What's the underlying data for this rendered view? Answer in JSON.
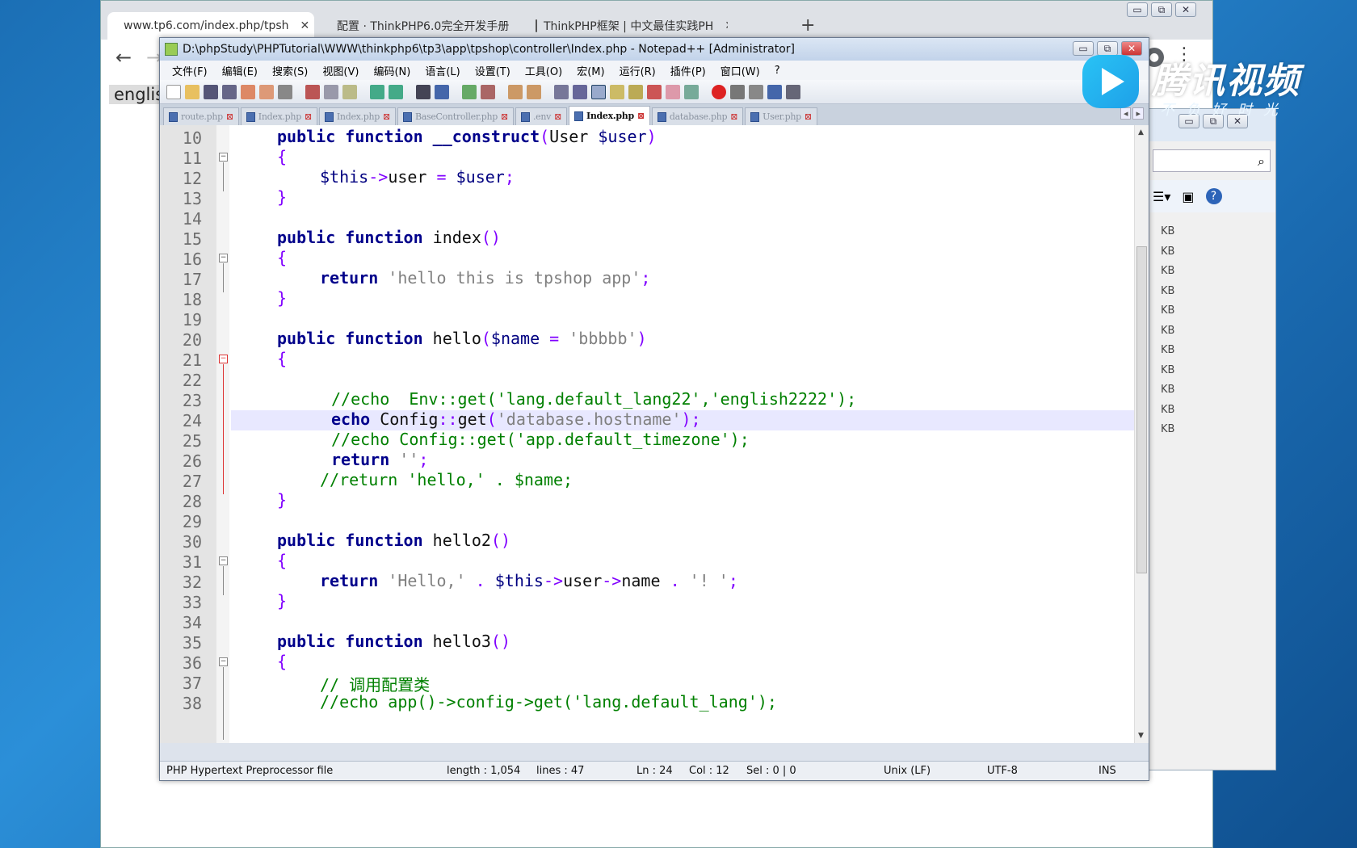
{
  "browser": {
    "tabs": [
      {
        "title": "www.tp6.com/index.php/tpsh",
        "close": "✕"
      },
      {
        "title": "配置 · ThinkPHP6.0完全开发手册",
        "close": "✕"
      },
      {
        "title": "ThinkPHP框架 | 中文最佳实践PH",
        "close": "✕"
      }
    ],
    "new_tab": "+",
    "page_text": "english",
    "win_buttons": [
      "▭",
      "⧉",
      "✕"
    ]
  },
  "explorer": {
    "kb_rows": [
      "KB",
      "KB",
      "KB",
      "KB",
      "KB",
      "KB",
      "KB",
      "KB",
      "KB",
      "KB",
      "KB"
    ],
    "win_buttons": [
      "▭",
      "⧉",
      "✕"
    ]
  },
  "npp": {
    "title": "D:\\phpStudy\\PHPTutorial\\WWW\\thinkphp6\\tp3\\app\\tpshop\\controller\\Index.php - Notepad++ [Administrator]",
    "win_buttons": [
      "▭",
      "⧉",
      "✕"
    ],
    "menu": [
      "文件(F)",
      "编辑(E)",
      "搜索(S)",
      "视图(V)",
      "编码(N)",
      "语言(L)",
      "设置(T)",
      "工具(O)",
      "宏(M)",
      "运行(R)",
      "插件(P)",
      "窗口(W)",
      "?"
    ],
    "file_tabs": [
      "route.php",
      "Index.php",
      "Index.php",
      "BaseController.php",
      ".env",
      "Index.php",
      "database.php",
      "User.php"
    ],
    "tab_arrows": [
      "◂",
      "▸"
    ],
    "status": {
      "lang": "PHP Hypertext Preprocessor file",
      "length": "length : 1,054",
      "lines": "lines : 47",
      "ln": "Ln : 24",
      "col": "Col : 12",
      "sel": "Sel : 0 | 0",
      "eol": "Unix (LF)",
      "enc": "UTF-8",
      "mode": "INS"
    },
    "line_numbers": [
      "10",
      "11",
      "12",
      "13",
      "14",
      "15",
      "16",
      "17",
      "18",
      "19",
      "20",
      "21",
      "22",
      "23",
      "24",
      "25",
      "26",
      "27",
      "28",
      "29",
      "30",
      "31",
      "32",
      "33",
      "34",
      "35",
      "36",
      "37",
      "38"
    ]
  },
  "code": {
    "l10a": "public function ",
    "l10b": "__construct",
    "l10c": "(",
    "l10d": "User ",
    "l10e": "$user",
    "l10f": ")",
    "brace_open": "{",
    "brace_close": "}",
    "l12a": "$this",
    "l12b": "->",
    "l12c": "user ",
    "l12d": "= ",
    "l12e": "$user",
    "l12f": ";",
    "l15a": "public function ",
    "l15b": "index",
    "l15c": "()",
    "l17a": "return ",
    "l17b": "'hello this is tpshop app'",
    "l17c": ";",
    "l20a": "public function ",
    "l20b": "hello",
    "l20c": "(",
    "l20d": "$name ",
    "l20e": "= ",
    "l20f": "'bbbbb'",
    "l20g": ")",
    "l23": "//echo  Env::get('lang.default_lang22','english2222');",
    "l24a": "echo ",
    "l24b": "Config",
    "l24c": "::",
    "l24d": "get",
    "l24e": "(",
    "l24f": "'database.hostname'",
    "l24g": ");",
    "l25": "//echo Config::get('app.default_timezone');",
    "l26a": "return ",
    "l26b": "''",
    "l26c": ";",
    "l27": "//return 'hello,' . $name;",
    "l30a": "public function ",
    "l30b": "hello2",
    "l30c": "()",
    "l32a": "return ",
    "l32b": "'Hello,' ",
    "l32c": ". ",
    "l32d": "$this",
    "l32e": "->",
    "l32f": "user",
    "l32g": "->",
    "l32h": "name ",
    "l32i": ". ",
    "l32j": "'! '",
    "l32k": ";",
    "l35a": "public function ",
    "l35b": "hello3",
    "l35c": "()",
    "l37": "// 调用配置类",
    "l38": "//echo app()->config->get('lang.default_lang');"
  },
  "watermark": {
    "name": "腾讯视频",
    "slogan": "不负好时光"
  }
}
